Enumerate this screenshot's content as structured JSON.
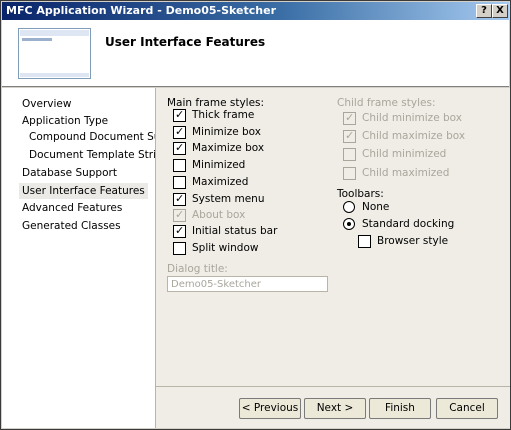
{
  "window": {
    "title": "MFC Application Wizard - Demo05-Sketcher",
    "help_label": "?",
    "close_label": "X"
  },
  "header": {
    "title": "User Interface Features"
  },
  "nav": {
    "items": [
      {
        "label": "Overview"
      },
      {
        "label": "Application Type"
      },
      {
        "label": "Compound Document Support"
      },
      {
        "label": "Document Template Strings"
      },
      {
        "label": "Database Support"
      },
      {
        "label": "User Interface Features"
      },
      {
        "label": "Advanced Features"
      },
      {
        "label": "Generated Classes"
      }
    ],
    "selected": "User Interface Features"
  },
  "main_frame": {
    "label": "Main frame styles:",
    "options": [
      {
        "label": "Thick frame",
        "checked": true,
        "enabled": true
      },
      {
        "label": "Minimize box",
        "checked": true,
        "enabled": true
      },
      {
        "label": "Maximize box",
        "checked": true,
        "enabled": true
      },
      {
        "label": "Minimized",
        "checked": false,
        "enabled": true
      },
      {
        "label": "Maximized",
        "checked": false,
        "enabled": true
      },
      {
        "label": "System menu",
        "checked": true,
        "enabled": true
      },
      {
        "label": "About box",
        "checked": true,
        "enabled": false
      },
      {
        "label": "Initial status bar",
        "checked": true,
        "enabled": true
      },
      {
        "label": "Split window",
        "checked": false,
        "enabled": true
      }
    ]
  },
  "child_frame": {
    "label": "Child frame styles:",
    "options": [
      {
        "label": "Child minimize box",
        "checked": true,
        "enabled": false
      },
      {
        "label": "Child maximize box",
        "checked": true,
        "enabled": false
      },
      {
        "label": "Child minimized",
        "checked": false,
        "enabled": false
      },
      {
        "label": "Child maximized",
        "checked": false,
        "enabled": false
      }
    ]
  },
  "toolbars": {
    "label": "Toolbars:",
    "options": [
      {
        "label": "None",
        "selected": false
      },
      {
        "label": "Standard docking",
        "selected": true
      }
    ],
    "browser_style": {
      "label": "Browser style",
      "checked": false
    }
  },
  "dialog_title": {
    "label": "Dialog title:",
    "value": "Demo05-Sketcher"
  },
  "buttons": {
    "previous": "< Previous",
    "next": "Next >",
    "finish": "Finish",
    "cancel": "Cancel"
  }
}
